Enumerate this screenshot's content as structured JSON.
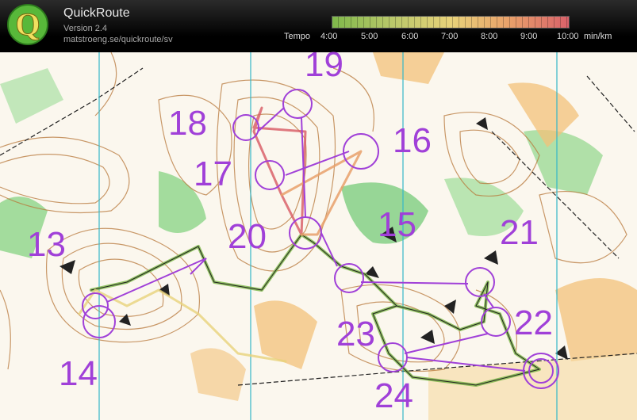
{
  "header": {
    "title": "QuickRoute",
    "version": "Version 2.4",
    "url": "matstroeng.se/quickroute/sv",
    "logo_letter": "Q"
  },
  "pace_scale": {
    "label": "Tempo",
    "ticks": [
      "4:00",
      "5:00",
      "6:00",
      "7:00",
      "8:00",
      "9:00",
      "10:00"
    ],
    "unit": "min/km",
    "colors": [
      "#7fb84b",
      "#b9c86a",
      "#e8d27a",
      "#e8a06a",
      "#d9626a"
    ]
  },
  "map": {
    "control_numbers": [
      "13",
      "14",
      "15",
      "16",
      "17",
      "18",
      "19",
      "20",
      "21",
      "22",
      "23",
      "24"
    ],
    "course_color": "#a040d8"
  }
}
